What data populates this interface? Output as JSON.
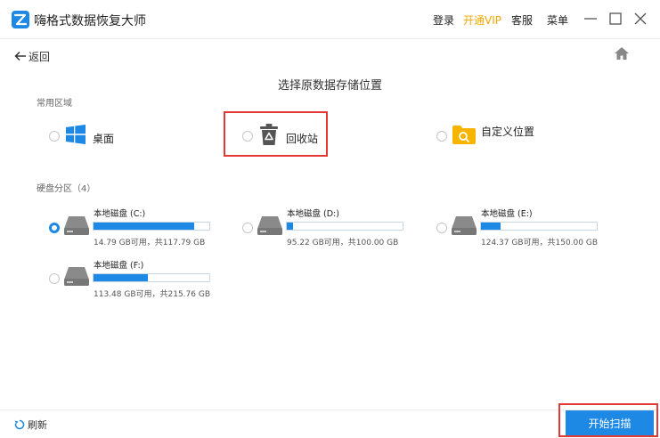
{
  "app": {
    "title": "嗨格式数据恢复大师",
    "accent": "#1e88e5",
    "highlight": "#e53935"
  },
  "header": {
    "login": "登录",
    "vip": "开通VIP",
    "service": "客服",
    "menu": "菜单"
  },
  "nav": {
    "back": "返回"
  },
  "page": {
    "title": "选择原数据存储位置"
  },
  "common_area": {
    "label": "常用区域",
    "options": [
      {
        "label": "桌面",
        "icon": "windows-icon"
      },
      {
        "label": "回收站",
        "icon": "recycle-bin-icon"
      },
      {
        "label": "自定义位置",
        "icon": "folder-search-icon"
      }
    ]
  },
  "drives": {
    "label": "硬盘分区（4）",
    "items": [
      {
        "name": "本地磁盘 (C:)",
        "info": "14.79 GB可用，共117.79 GB",
        "used_fraction": 0.87,
        "selected": true
      },
      {
        "name": "本地磁盘 (D:)",
        "info": "95.22 GB可用，共100.00 GB",
        "used_fraction": 0.05,
        "selected": false
      },
      {
        "name": "本地磁盘 (E:)",
        "info": "124.37 GB可用，共150.00 GB",
        "used_fraction": 0.17,
        "selected": false
      },
      {
        "name": "本地磁盘 (F:)",
        "info": "113.48 GB可用，共215.76 GB",
        "used_fraction": 0.47,
        "selected": false
      }
    ]
  },
  "footer": {
    "refresh": "刷新",
    "scan": "开始扫描"
  }
}
